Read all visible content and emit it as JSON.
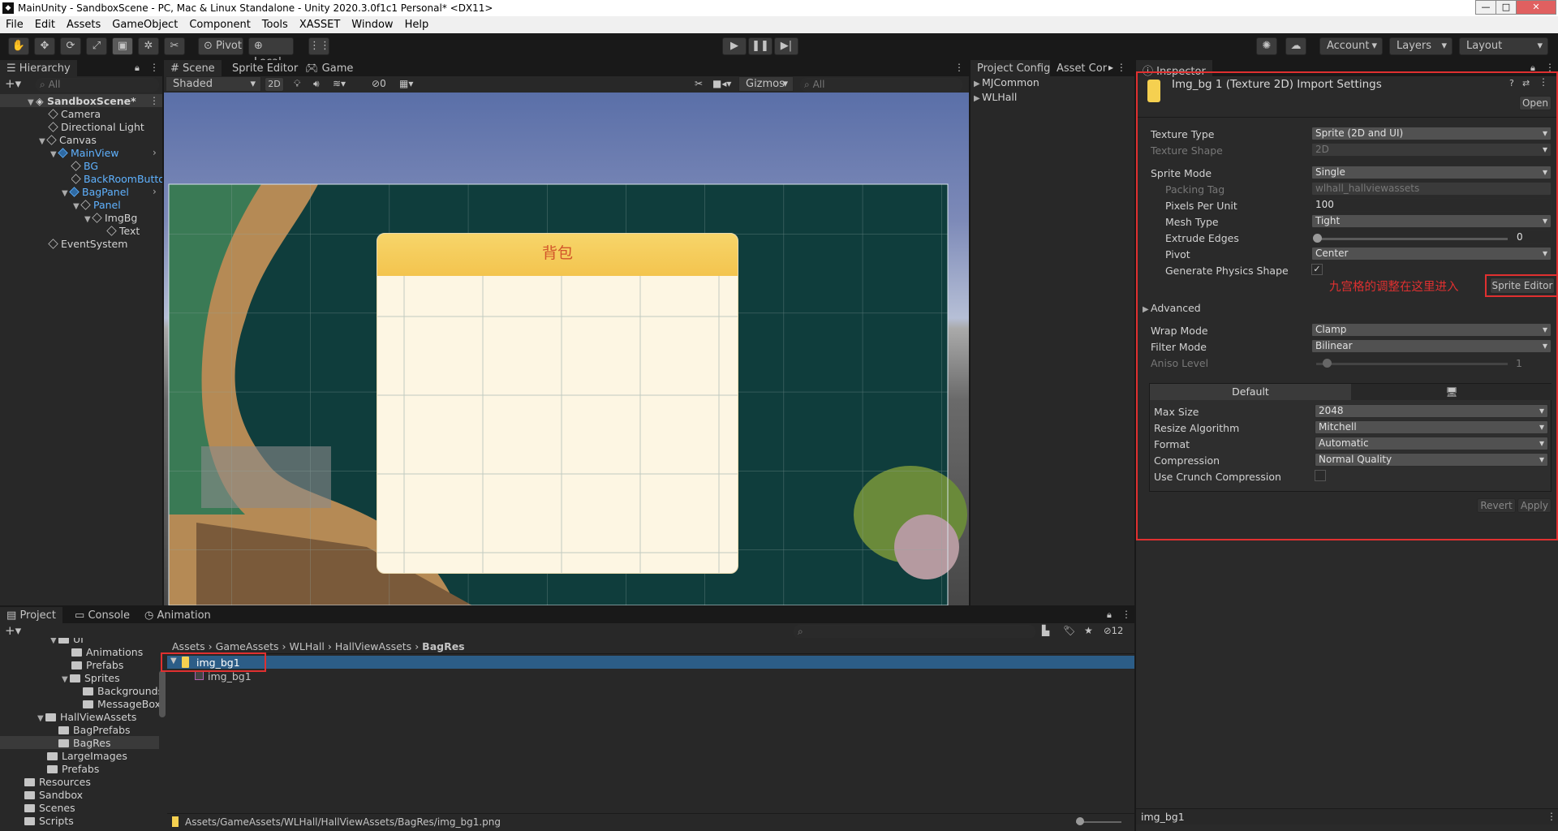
{
  "window": {
    "title": "MainUnity - SandboxScene - PC, Mac & Linux Standalone - Unity 2020.3.0f1c1 Personal* <DX11>"
  },
  "menu": [
    "File",
    "Edit",
    "Assets",
    "GameObject",
    "Component",
    "Tools",
    "XASSET",
    "Window",
    "Help"
  ],
  "toolbar": {
    "pivot": "Pivot",
    "local": "Local",
    "account": "Account",
    "layers": "Layers",
    "layout": "Layout"
  },
  "hierarchy": {
    "tab": "Hierarchy",
    "search_placeholder": "All",
    "items": [
      {
        "label": "SandboxScene*",
        "depth": 0
      },
      {
        "label": "Camera",
        "depth": 1
      },
      {
        "label": "Directional Light",
        "depth": 1
      },
      {
        "label": "Canvas",
        "depth": 1
      },
      {
        "label": "MainView",
        "depth": 2
      },
      {
        "label": "BG",
        "depth": 3
      },
      {
        "label": "BackRoomButto",
        "depth": 3
      },
      {
        "label": "BagPanel",
        "depth": 3
      },
      {
        "label": "Panel",
        "depth": 4
      },
      {
        "label": "ImgBg",
        "depth": 5
      },
      {
        "label": "Text",
        "depth": 6
      },
      {
        "label": "EventSystem",
        "depth": 1
      }
    ]
  },
  "scene": {
    "tabs": [
      "Scene",
      "Sprite Editor",
      "Game"
    ],
    "shading": "Shaded",
    "mode2d": "2D",
    "hidden_count": "0",
    "gizmos": "Gizmos",
    "search_placeholder": "All",
    "panel_title": "背包"
  },
  "project_config": {
    "tabs": [
      "Project Config",
      "Asset Cor"
    ],
    "items": [
      "MJCommon",
      "WLHall"
    ]
  },
  "inspector": {
    "tab": "Inspector",
    "title": "Img_bg 1 (Texture 2D) Import Settings",
    "open": "Open",
    "texture_type_label": "Texture Type",
    "texture_type": "Sprite (2D and UI)",
    "texture_shape_label": "Texture Shape",
    "texture_shape": "2D",
    "sprite_mode_label": "Sprite Mode",
    "sprite_mode": "Single",
    "packing_tag_label": "Packing Tag",
    "packing_tag": "wlhall_hallviewassets",
    "ppu_label": "Pixels Per Unit",
    "ppu": "100",
    "mesh_type_label": "Mesh Type",
    "mesh_type": "Tight",
    "extrude_label": "Extrude Edges",
    "extrude": "0",
    "pivot_label": "Pivot",
    "pivot": "Center",
    "physics_label": "Generate Physics Shape",
    "annotation": "九宫格的调整在这里进入",
    "sprite_editor_button": "Sprite Editor",
    "advanced": "Advanced",
    "wrap_label": "Wrap Mode",
    "wrap": "Clamp",
    "filter_label": "Filter Mode",
    "filter": "Bilinear",
    "aniso_label": "Aniso Level",
    "aniso": "1",
    "platform_tab": "Default",
    "max_size_label": "Max Size",
    "max_size": "2048",
    "resize_label": "Resize Algorithm",
    "resize": "Mitchell",
    "format_label": "Format",
    "format": "Automatic",
    "compression_label": "Compression",
    "compression": "Normal Quality",
    "crunch_label": "Use Crunch Compression",
    "revert": "Revert",
    "apply": "Apply",
    "footer": "img_bg1"
  },
  "project": {
    "tabs": [
      "Project",
      "Console",
      "Animation"
    ],
    "count": "12",
    "breadcrumb": [
      "Assets",
      "GameAssets",
      "WLHall",
      "HallViewAssets",
      "BagRes"
    ],
    "tree": [
      {
        "label": "UI",
        "depth": 2
      },
      {
        "label": "Animations",
        "depth": 3
      },
      {
        "label": "Prefabs",
        "depth": 3
      },
      {
        "label": "Sprites",
        "depth": 3
      },
      {
        "label": "Backgrounds",
        "depth": 4
      },
      {
        "label": "MessageBox",
        "depth": 4
      },
      {
        "label": "HallViewAssets",
        "depth": 1
      },
      {
        "label": "BagPrefabs",
        "depth": 2
      },
      {
        "label": "BagRes",
        "depth": 2
      },
      {
        "label": "LargeImages",
        "depth": 1
      },
      {
        "label": "Prefabs",
        "depth": 1
      },
      {
        "label": "Resources",
        "depth": 0
      },
      {
        "label": "Sandbox",
        "depth": 0
      },
      {
        "label": "Scenes",
        "depth": 0
      },
      {
        "label": "Scripts",
        "depth": 0
      }
    ],
    "asset": "img_bg1",
    "sub_asset": "img_bg1",
    "path": "Assets/GameAssets/WLHall/HallViewAssets/BagRes/img_bg1.png"
  },
  "colors": {
    "accent": "#2c5d87",
    "highlight": "#e03030",
    "unity_bg": "#282828"
  }
}
